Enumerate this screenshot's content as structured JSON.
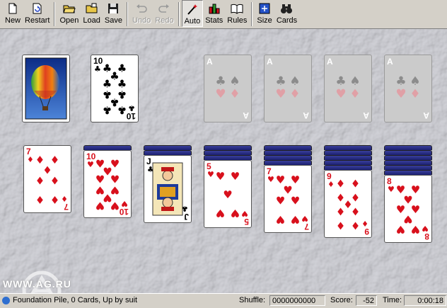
{
  "toolbar": {
    "new": {
      "label": "New",
      "icon": "new-page-icon"
    },
    "restart": {
      "label": "Restart",
      "icon": "restart-icon"
    },
    "open": {
      "label": "Open",
      "icon": "open-folder-icon"
    },
    "load": {
      "label": "Load",
      "icon": "load-folder-icon"
    },
    "save": {
      "label": "Save",
      "icon": "floppy-disk-icon"
    },
    "undo": {
      "label": "Undo",
      "icon": "undo-arrow-icon"
    },
    "redo": {
      "label": "Redo",
      "icon": "redo-arrow-icon"
    },
    "auto": {
      "label": "Auto",
      "icon": "magic-wand-icon"
    },
    "stats": {
      "label": "Stats",
      "icon": "bar-chart-icon"
    },
    "rules": {
      "label": "Rules",
      "icon": "rules-book-icon"
    },
    "size": {
      "label": "Size",
      "icon": "resize-icon"
    },
    "cards": {
      "label": "Cards",
      "icon": "binoculars-icon"
    }
  },
  "table": {
    "stock": {
      "face": "down",
      "back_image": "hot-air-balloon"
    },
    "waste": {
      "rank": "10",
      "suit": "clubs"
    },
    "foundations": [
      {
        "empty": true,
        "placeholder": "A"
      },
      {
        "empty": true,
        "placeholder": "A"
      },
      {
        "empty": true,
        "placeholder": "A"
      },
      {
        "empty": true,
        "placeholder": "A"
      }
    ],
    "tableau": [
      {
        "hidden": 0,
        "top": {
          "rank": "7",
          "suit": "diamonds"
        }
      },
      {
        "hidden": 1,
        "top": {
          "rank": "10",
          "suit": "hearts"
        }
      },
      {
        "hidden": 2,
        "top": {
          "rank": "J",
          "suit": "clubs"
        }
      },
      {
        "hidden": 3,
        "top": {
          "rank": "5",
          "suit": "hearts"
        }
      },
      {
        "hidden": 4,
        "top": {
          "rank": "7",
          "suit": "hearts"
        }
      },
      {
        "hidden": 5,
        "top": {
          "rank": "9",
          "suit": "diamonds"
        }
      },
      {
        "hidden": 6,
        "top": {
          "rank": "8",
          "suit": "hearts"
        }
      }
    ],
    "watermark": "WWW.AG.RU"
  },
  "status": {
    "message": "Foundation Pile, 0 Cards, Up by suit",
    "shuffle_label": "Shuffle:",
    "shuffle_value": "0000000000",
    "score_label": "Score:",
    "score_value": "-52",
    "time_label": "Time:",
    "time_value": "0:00:18"
  },
  "colors": {
    "red_suit": "#d8101c",
    "black_suit": "#000000",
    "card_back": "#23287a",
    "felt": "#cdced4"
  }
}
